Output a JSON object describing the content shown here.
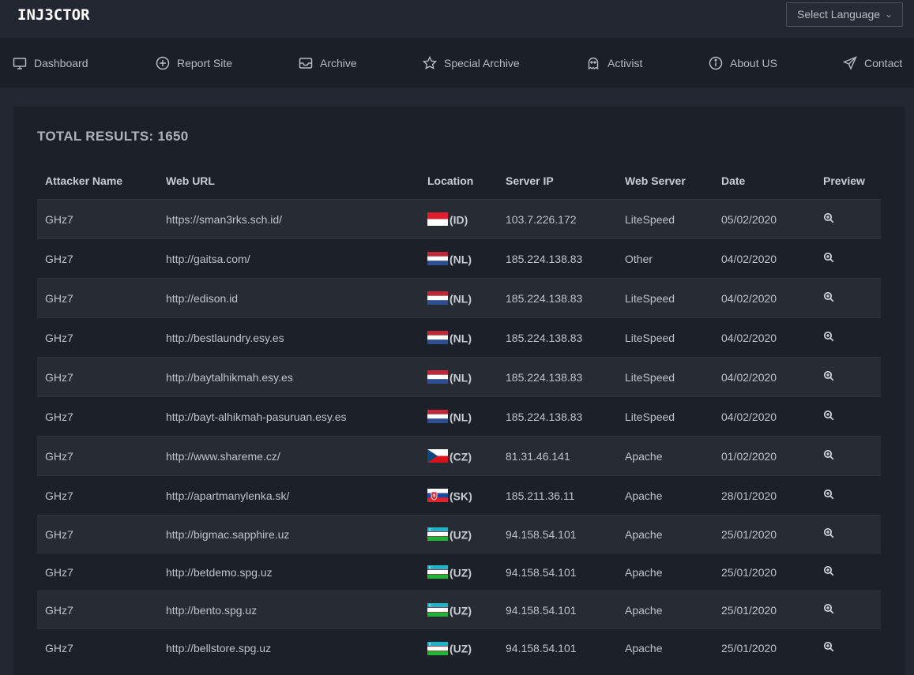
{
  "brand": {
    "logo": "INJ3CTOR"
  },
  "language_select": {
    "label": "Select Language"
  },
  "nav": [
    {
      "label": "Dashboard",
      "icon": "monitor-icon"
    },
    {
      "label": "Report Site",
      "icon": "plus-circle-icon"
    },
    {
      "label": "Archive",
      "icon": "inbox-icon"
    },
    {
      "label": "Special Archive",
      "icon": "star-icon"
    },
    {
      "label": "Activist",
      "icon": "ghost-icon"
    },
    {
      "label": "About US",
      "icon": "info-icon"
    },
    {
      "label": "Contact",
      "icon": "send-icon"
    }
  ],
  "results": {
    "label": "TOTAL RESULTS: 1650"
  },
  "table": {
    "headers": [
      "Attacker Name",
      "Web URL",
      "Location",
      "Server IP",
      "Web Server",
      "Date",
      "Preview"
    ],
    "rows": [
      {
        "attacker": "GHz7",
        "url": "https://sman3rks.sch.id/",
        "country": "(ID)",
        "ip": "103.7.226.172",
        "server": "LiteSpeed",
        "date": "05/02/2020"
      },
      {
        "attacker": "GHz7",
        "url": "http://gaitsa.com/",
        "country": "(NL)",
        "ip": "185.224.138.83",
        "server": "Other",
        "date": "04/02/2020"
      },
      {
        "attacker": "GHz7",
        "url": "http://edison.id",
        "country": "(NL)",
        "ip": "185.224.138.83",
        "server": "LiteSpeed",
        "date": "04/02/2020"
      },
      {
        "attacker": "GHz7",
        "url": "http://bestlaundry.esy.es",
        "country": "(NL)",
        "ip": "185.224.138.83",
        "server": "LiteSpeed",
        "date": "04/02/2020"
      },
      {
        "attacker": "GHz7",
        "url": "http://baytalhikmah.esy.es",
        "country": "(NL)",
        "ip": "185.224.138.83",
        "server": "LiteSpeed",
        "date": "04/02/2020"
      },
      {
        "attacker": "GHz7",
        "url": "http://bayt-alhikmah-pasuruan.esy.es",
        "country": "(NL)",
        "ip": "185.224.138.83",
        "server": "LiteSpeed",
        "date": "04/02/2020"
      },
      {
        "attacker": "GHz7",
        "url": "http://www.shareme.cz/",
        "country": "(CZ)",
        "ip": "81.31.46.141",
        "server": "Apache",
        "date": "01/02/2020"
      },
      {
        "attacker": "GHz7",
        "url": "http://apartmanylenka.sk/",
        "country": "(SK)",
        "ip": "185.211.36.11",
        "server": "Apache",
        "date": "28/01/2020"
      },
      {
        "attacker": "GHz7",
        "url": "http://bigmac.sapphire.uz",
        "country": "(UZ)",
        "ip": "94.158.54.101",
        "server": "Apache",
        "date": "25/01/2020"
      },
      {
        "attacker": "GHz7",
        "url": "http://betdemo.spg.uz",
        "country": "(UZ)",
        "ip": "94.158.54.101",
        "server": "Apache",
        "date": "25/01/2020"
      },
      {
        "attacker": "GHz7",
        "url": "http://bento.spg.uz",
        "country": "(UZ)",
        "ip": "94.158.54.101",
        "server": "Apache",
        "date": "25/01/2020"
      },
      {
        "attacker": "GHz7",
        "url": "http://bellstore.spg.uz",
        "country": "(UZ)",
        "ip": "94.158.54.101",
        "server": "Apache",
        "date": "25/01/2020"
      }
    ]
  }
}
